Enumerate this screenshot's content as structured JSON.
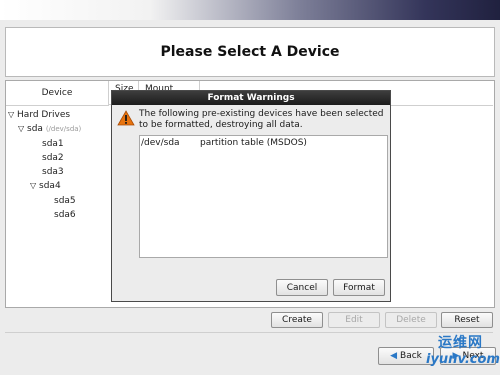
{
  "page": {
    "title": "Please Select A Device"
  },
  "columns": {
    "device": "Device",
    "size": "Size",
    "mount": "Mount Point/"
  },
  "tree": {
    "hard_drives": "Hard Drives",
    "sda": {
      "label": "sda",
      "sub": "(/dev/sda)"
    },
    "items": [
      "sda1",
      "sda2",
      "sda3"
    ],
    "sda4": "sda4",
    "sda4_children": [
      "sda5",
      "sda6"
    ]
  },
  "dialog": {
    "title": "Format Warnings",
    "message": "The following pre-existing devices have been selected to be formatted, destroying all data.",
    "list": [
      {
        "device": "/dev/sda",
        "desc": "partition table (MSDOS)"
      }
    ],
    "cancel": "Cancel",
    "format": "Format"
  },
  "toolbar": {
    "create": "Create",
    "edit": "Edit",
    "delete": "Delete",
    "reset": "Reset"
  },
  "nav": {
    "back": "Back",
    "next": "Next"
  },
  "watermark": {
    "cn": "运维网",
    "url": "iyunv.com"
  },
  "colors": {
    "warning": "#e8740f",
    "dialog_title_bg": "#1c1c1c",
    "link_blue": "#2a78c6"
  }
}
